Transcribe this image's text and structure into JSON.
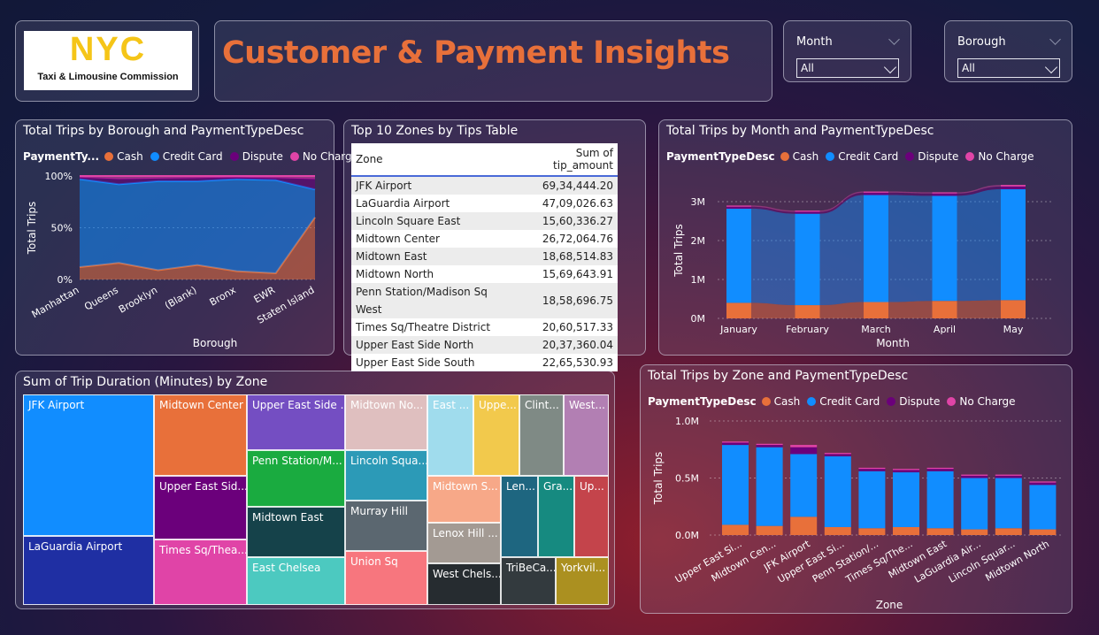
{
  "header": {
    "logo_text": "NYC",
    "logo_subtitle": "Taxi & Limousine Commission",
    "title": "Customer & Payment Insights"
  },
  "slicers": {
    "month": {
      "label": "Month",
      "value": "All"
    },
    "borough": {
      "label": "Borough",
      "value": "All"
    }
  },
  "colors": {
    "cash": "#e8703a",
    "credit_card": "#118dff",
    "dispute": "#6b007b",
    "no_charge": "#e044a7",
    "title": "#e8703a"
  },
  "legend": {
    "title_short": "PaymentTy...",
    "title": "PaymentTypeDesc",
    "items": [
      "Cash",
      "Credit Card",
      "Dispute",
      "No Charge"
    ]
  },
  "chart_data": [
    {
      "type": "area",
      "title": "Total Trips by Borough and PaymentTypeDesc",
      "subtype": "100% stacked",
      "xlabel": "Borough",
      "ylabel": "Total Trips",
      "yticks": [
        "0%",
        "50%",
        "100%"
      ],
      "categories": [
        "Manhattan",
        "Queens",
        "Brooklyn",
        "(Blank)",
        "Bronx",
        "EWR",
        "Staten Island"
      ],
      "series": [
        {
          "name": "Cash",
          "values": [
            12,
            16,
            9,
            14,
            8,
            6,
            60
          ]
        },
        {
          "name": "Credit Card",
          "values": [
            85,
            76,
            86,
            81,
            89,
            90,
            27
          ]
        },
        {
          "name": "Dispute",
          "values": [
            1.5,
            5,
            2.5,
            3,
            1.5,
            2,
            10
          ]
        },
        {
          "name": "No Charge",
          "values": [
            1.5,
            3,
            2.5,
            2,
            1.5,
            2,
            3
          ]
        }
      ]
    },
    {
      "type": "table",
      "title": "Top 10 Zones by Tips Table",
      "columns": [
        "Zone",
        "Sum of tip_amount"
      ],
      "rows": [
        [
          "JFK Airport",
          "69,34,444.20"
        ],
        [
          "LaGuardia Airport",
          "47,09,026.63"
        ],
        [
          "Lincoln Square East",
          "15,60,336.27"
        ],
        [
          "Midtown Center",
          "26,72,064.76"
        ],
        [
          "Midtown East",
          "18,68,514.83"
        ],
        [
          "Midtown North",
          "15,69,643.91"
        ],
        [
          "Penn Station/Madison Sq West",
          "18,58,696.75"
        ],
        [
          "Times Sq/Theatre District",
          "20,60,517.33"
        ],
        [
          "Upper East Side North",
          "20,37,360.04"
        ],
        [
          "Upper East Side South",
          "22,65,530.93"
        ]
      ]
    },
    {
      "type": "bar",
      "subtype": "stacked ribbon",
      "title": "Total Trips by Month and PaymentTypeDesc",
      "xlabel": "Month",
      "ylabel": "Total Trips",
      "yticks": [
        "0M",
        "1M",
        "2M",
        "3M"
      ],
      "ylim": [
        0,
        3.5
      ],
      "categories": [
        "January",
        "February",
        "March",
        "April",
        "May"
      ],
      "series": [
        {
          "name": "Cash",
          "values": [
            0.4,
            0.34,
            0.42,
            0.45,
            0.47
          ]
        },
        {
          "name": "Credit Card",
          "values": [
            2.42,
            2.35,
            2.75,
            2.7,
            2.85
          ]
        },
        {
          "name": "Dispute",
          "values": [
            0.05,
            0.05,
            0.06,
            0.06,
            0.07
          ]
        },
        {
          "name": "No Charge",
          "values": [
            0.03,
            0.03,
            0.03,
            0.03,
            0.04
          ]
        }
      ]
    },
    {
      "type": "heatmap",
      "subtype": "treemap",
      "title": "Sum of Trip Duration (Minutes) by Zone",
      "labels": [
        "JFK Airport",
        "LaGuardia Airport",
        "Midtown Center",
        "Upper East Sid...",
        "Times Sq/Thea...",
        "Upper East Side ...",
        "Penn Station/M...",
        "Midtown East",
        "East Chelsea",
        "Midtown No...",
        "Lincoln Squa...",
        "Murray Hill",
        "Union Sq",
        "East ...",
        "Uppe...",
        "Clint...",
        "West...",
        "Midtown S...",
        "Lenox Hill ...",
        "West Chels...",
        "Len...",
        "Gra...",
        "Up...",
        "TriBeCa...",
        "Yorkvil..."
      ]
    },
    {
      "type": "bar",
      "subtype": "stacked",
      "title": "Total Trips by Zone and PaymentTypeDesc",
      "xlabel": "Zone",
      "ylabel": "Total Trips",
      "yticks": [
        "0.0M",
        "0.5M",
        "1.0M"
      ],
      "ylim": [
        0,
        1.0
      ],
      "categories": [
        "Upper East Si...",
        "Midtown Cen...",
        "JFK Airport",
        "Upper East Si...",
        "Penn Station/...",
        "Times Sq/The...",
        "Midtown East",
        "LaGuardia Air...",
        "Lincoln Squar...",
        "Midtown North"
      ],
      "series": [
        {
          "name": "Cash",
          "values": [
            0.09,
            0.08,
            0.16,
            0.07,
            0.06,
            0.07,
            0.06,
            0.05,
            0.06,
            0.05
          ]
        },
        {
          "name": "Credit Card",
          "values": [
            0.7,
            0.69,
            0.55,
            0.62,
            0.5,
            0.48,
            0.5,
            0.45,
            0.44,
            0.39
          ]
        },
        {
          "name": "Dispute",
          "values": [
            0.02,
            0.02,
            0.06,
            0.02,
            0.02,
            0.02,
            0.02,
            0.02,
            0.02,
            0.02
          ]
        },
        {
          "name": "No Charge",
          "values": [
            0.01,
            0.01,
            0.02,
            0.01,
            0.01,
            0.01,
            0.01,
            0.01,
            0.01,
            0.01
          ]
        }
      ]
    }
  ]
}
